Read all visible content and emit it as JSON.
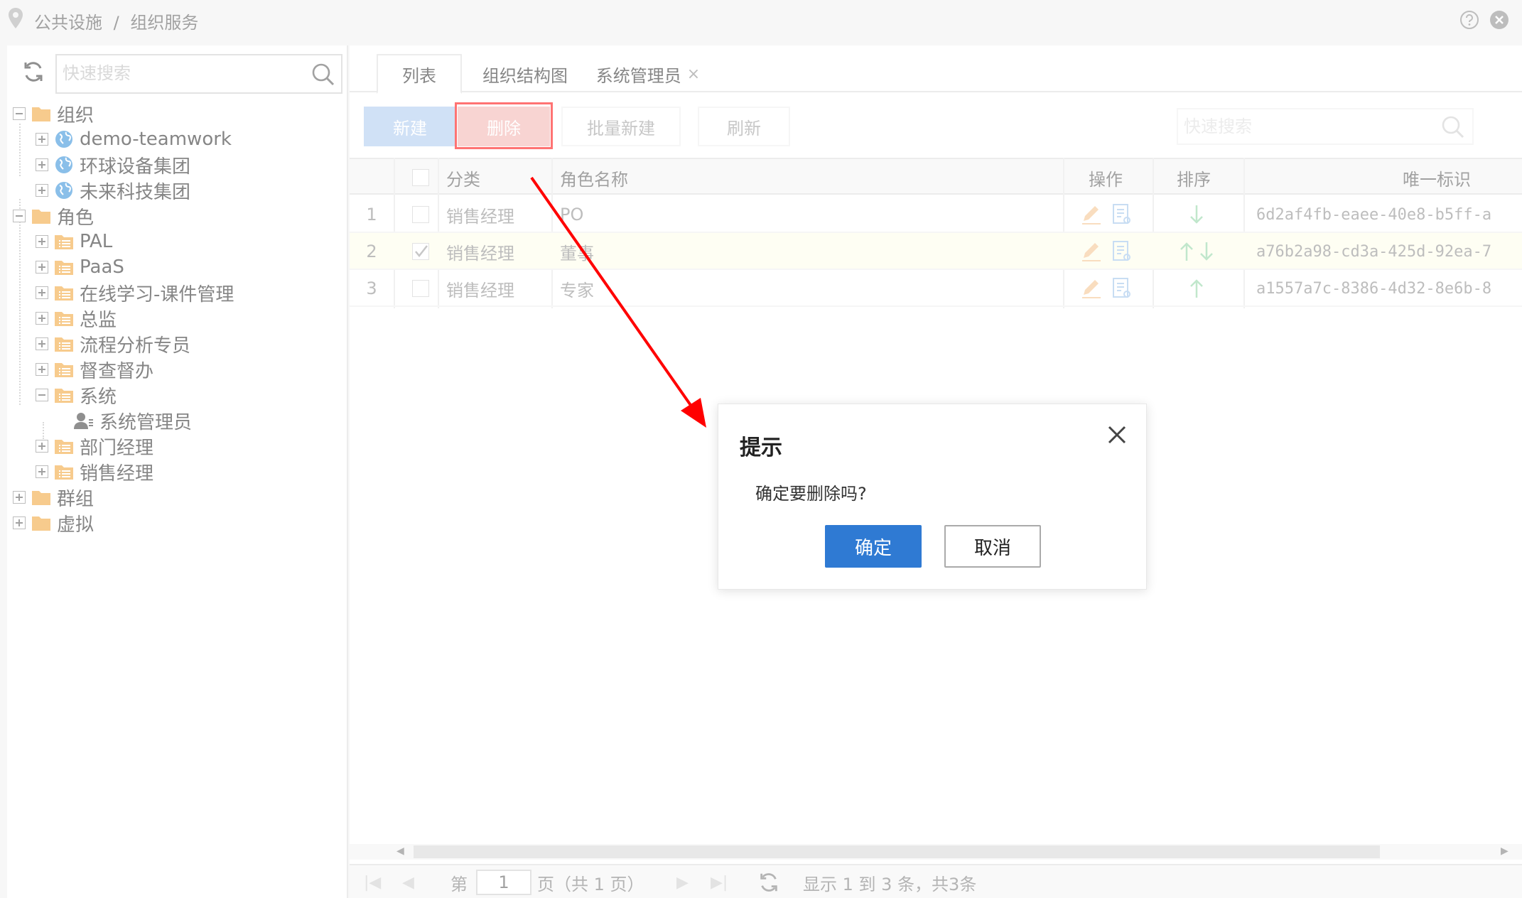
{
  "breadcrumb": {
    "part1": "公共设施",
    "sep": "/",
    "part2": "组织服务"
  },
  "left_search": {
    "placeholder": "快速搜索"
  },
  "tree": {
    "org": "组织",
    "org_children": [
      "demo-teamwork",
      "环球设备集团",
      "未来科技集团"
    ],
    "role": "角色",
    "role_children": [
      "PAL",
      "PaaS",
      "在线学习-课件管理",
      "总监",
      "流程分析专员",
      "督查督办",
      "系统"
    ],
    "system_child": "系统管理员",
    "role_children_after": [
      "部门经理",
      "销售经理"
    ],
    "group": "群组",
    "virtual": "虚拟"
  },
  "tabs": [
    {
      "label": "列表"
    },
    {
      "label": "组织结构图"
    },
    {
      "label": "系统管理员",
      "close": "×"
    }
  ],
  "toolbar": {
    "new_label": "新建",
    "delete_label": "删除",
    "batch_label": "批量新建",
    "refresh_label": "刷新",
    "search_placeholder": "快速搜索"
  },
  "table": {
    "headers": {
      "category": "分类",
      "role_name": "角色名称",
      "ops": "操作",
      "sort": "排序",
      "uid": "唯一标识"
    },
    "rows": [
      {
        "num": "1",
        "category": "销售经理",
        "role_name": "PO",
        "uid": "6d2af4fb-eaee-40e8-b5ff-a",
        "checked": false
      },
      {
        "num": "2",
        "category": "销售经理",
        "role_name": "董事",
        "uid": "a76b2a98-cd3a-425d-92ea-7",
        "checked": true
      },
      {
        "num": "3",
        "category": "销售经理",
        "role_name": "专家",
        "uid": "a1557a7c-8386-4d32-8e6b-8",
        "checked": false
      }
    ]
  },
  "pager": {
    "page_prefix": "第",
    "page_value": "1",
    "page_suffix": "页（共 1 页）",
    "summary": "显示 1 到 3 条，共3条"
  },
  "dialog": {
    "title": "提示",
    "message": "确定要删除吗?",
    "ok_label": "确定",
    "cancel_label": "取消"
  },
  "colors": {
    "accent": "#2f7ad3",
    "new_button": "#a9c8ee",
    "delete_button": "#f2b1ad",
    "annotation_red": "#ff0000",
    "folder": "#f0a030",
    "globe": "#2a8ad8",
    "arrow_green": "#8ed3a3"
  }
}
